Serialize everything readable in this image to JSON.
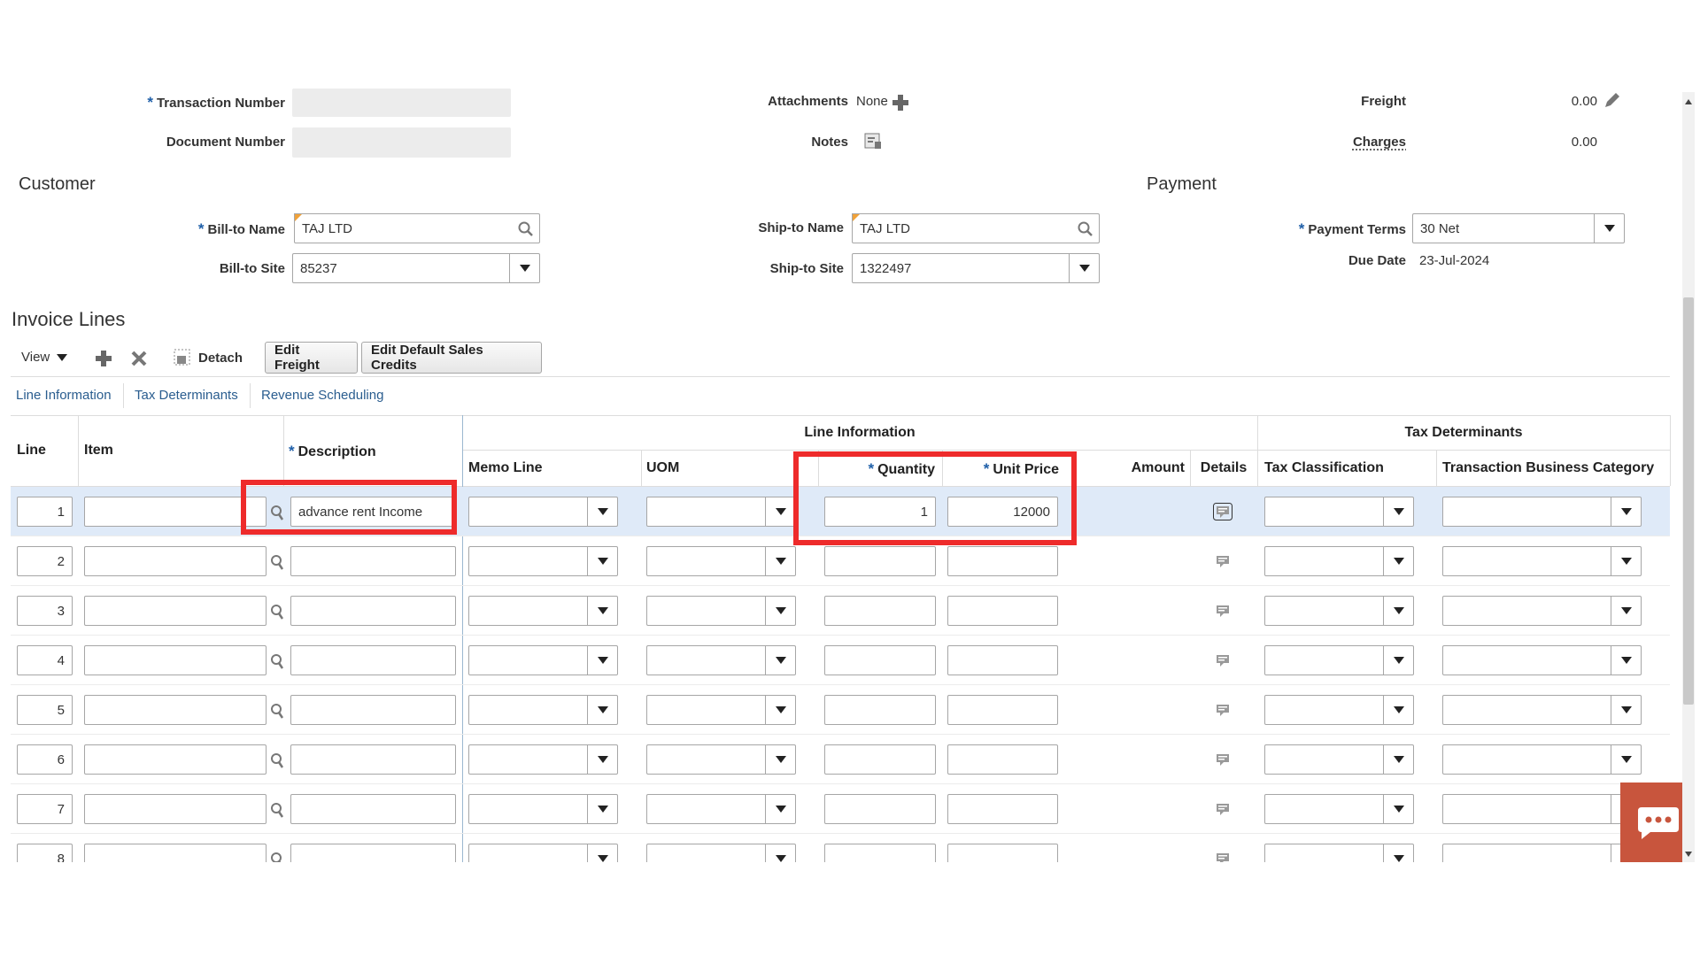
{
  "header": {
    "transaction_number_label": "Transaction Number",
    "document_number_label": "Document Number",
    "attachments_label": "Attachments",
    "attachments_value": "None",
    "notes_label": "Notes",
    "freight_label": "Freight",
    "freight_value": "0.00",
    "charges_label": "Charges",
    "charges_value": "0.00"
  },
  "customer": {
    "title": "Customer",
    "bill_to_name_label": "Bill-to Name",
    "bill_to_name_value": "TAJ LTD",
    "bill_to_site_label": "Bill-to Site",
    "bill_to_site_value": "85237",
    "ship_to_name_label": "Ship-to Name",
    "ship_to_name_value": "TAJ LTD",
    "ship_to_site_label": "Ship-to Site",
    "ship_to_site_value": "1322497"
  },
  "payment": {
    "title": "Payment",
    "payment_terms_label": "Payment Terms",
    "payment_terms_value": "30 Net",
    "due_date_label": "Due Date",
    "due_date_value": "23-Jul-2024"
  },
  "invoice_lines": {
    "title": "Invoice Lines",
    "toolbar": {
      "view_label": "View",
      "detach_label": "Detach",
      "edit_freight_label": "Edit Freight",
      "edit_default_sales_credits_label": "Edit Default Sales Credits"
    },
    "tabs": [
      "Line Information",
      "Tax Determinants",
      "Revenue Scheduling"
    ],
    "group_headers": {
      "line_information": "Line Information",
      "tax_determinants": "Tax Determinants"
    },
    "columns": {
      "line": "Line",
      "item": "Item",
      "description": "Description",
      "memo_line": "Memo Line",
      "uom": "UOM",
      "quantity": "Quantity",
      "unit_price": "Unit Price",
      "amount": "Amount",
      "details": "Details",
      "tax_classification": "Tax Classification",
      "transaction_business_category": "Transaction Business Category"
    },
    "rows": [
      {
        "line": "1",
        "description": "advance rent Income",
        "quantity": "1",
        "unit_price": "12000"
      },
      {
        "line": "2",
        "description": "",
        "quantity": "",
        "unit_price": ""
      },
      {
        "line": "3",
        "description": "",
        "quantity": "",
        "unit_price": ""
      },
      {
        "line": "4",
        "description": "",
        "quantity": "",
        "unit_price": ""
      },
      {
        "line": "5",
        "description": "",
        "quantity": "",
        "unit_price": ""
      },
      {
        "line": "6",
        "description": "",
        "quantity": "",
        "unit_price": ""
      },
      {
        "line": "7",
        "description": "",
        "quantity": "",
        "unit_price": ""
      },
      {
        "line": "8",
        "description": "",
        "quantity": "",
        "unit_price": ""
      }
    ]
  },
  "colors": {
    "required_star": "#1f5fa8",
    "highlight_row": "#dfeaf8",
    "callout_red": "#ee2b2b",
    "chat_button": "#c8553d"
  }
}
